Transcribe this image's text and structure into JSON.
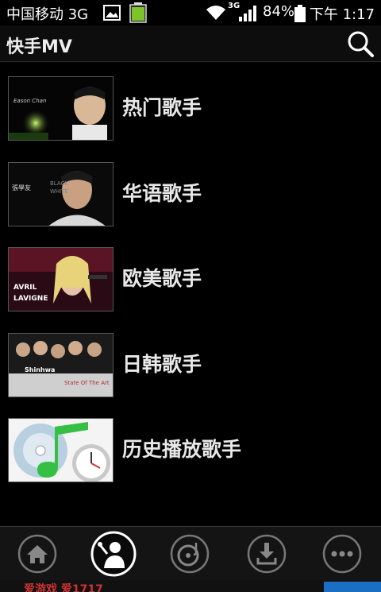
{
  "status_bar": {
    "carrier": "中国移动 3G",
    "signal_label": "3G",
    "battery": "84%",
    "time": "下午 1:17"
  },
  "app_bar": {
    "title": "快手MV",
    "search_icon": "search-icon"
  },
  "categories": [
    {
      "label": "热门歌手"
    },
    {
      "label": "华语歌手"
    },
    {
      "label": "欧美歌手"
    },
    {
      "label": "日韩歌手"
    },
    {
      "label": "历史播放歌手"
    }
  ],
  "bottom_nav": [
    {
      "icon": "home-icon",
      "active": false
    },
    {
      "icon": "singer-icon",
      "active": true
    },
    {
      "icon": "disc-icon",
      "active": false
    },
    {
      "icon": "download-icon",
      "active": false
    },
    {
      "icon": "more-icon",
      "active": false
    }
  ],
  "ad": {
    "text": "爱游戏 爱1717"
  },
  "colors": {
    "background": "#000000",
    "appbar": "#0d0d0d",
    "bottombar": "#141414"
  }
}
